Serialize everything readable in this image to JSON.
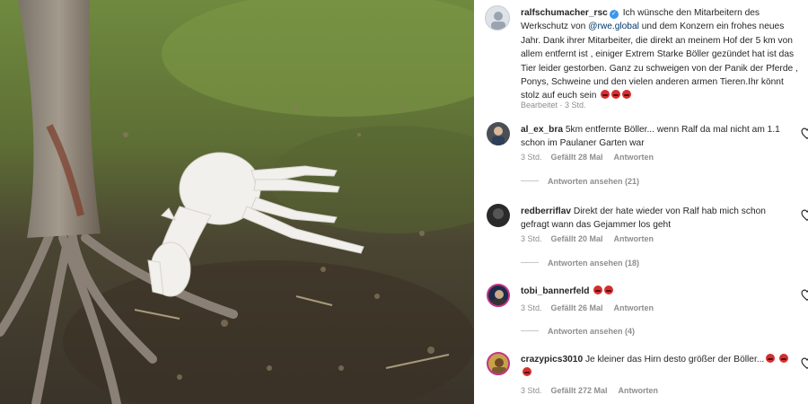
{
  "post": {
    "image_alt": "",
    "author": "ralfschumacher_rsc",
    "caption_lead": "Ich wünsche den Mitarbeitern des Werkschutz von ",
    "mention": "@rwe.global",
    "caption_rest": " und dem Konzern ein frohes neues Jahr. Dank ihrer Mitarbeiter, die direkt an meinem Hof der 5 km von allem entfernt ist , einiger Extrem Starke Böller gezündet hat ist das Tier leider gestorben. Ganz zu schweigen von der Panik der Pferde , Ponys, Schweine und den vielen anderen armen Tieren.Ihr könnt stolz auf euch sein",
    "edited_label": "Bearbeitet",
    "time": "3 Std."
  },
  "comments": [
    {
      "user": "al_ex_bra",
      "text": "5km entfernte Böller... wenn Ralf da mal nicht am 1.1 schon im Paulaner Garten war",
      "time": "3 Std.",
      "likes": "Gefällt 28 Mal",
      "reply": "Antworten",
      "view_replies": "Antworten ansehen (21)"
    },
    {
      "user": "redberriflav",
      "text": "Direkt der hate wieder von Ralf hab mich schon gefragt wann das Gejammer los geht",
      "time": "3 Std.",
      "likes": "Gefällt 20 Mal",
      "reply": "Antworten",
      "view_replies": "Antworten ansehen (18)"
    },
    {
      "user": "tobi_bannerfeld",
      "text": "",
      "time": "3 Std.",
      "likes": "Gefällt 26 Mal",
      "reply": "Antworten",
      "view_replies": "Antworten ansehen (4)"
    },
    {
      "user": "crazypics3010",
      "text": "Je kleiner das Hirn desto größer der Böller...",
      "time": "3 Std.",
      "likes": "Gefällt 272 Mal",
      "reply": "Antworten"
    }
  ],
  "colors": {
    "link": "#00376b",
    "muted": "#8e8e8e",
    "verified": "#3897f0",
    "emoji": "#d32f2f"
  },
  "icons": [
    "verified-badge-icon",
    "angry-face-emoji-icon",
    "heart-icon"
  ]
}
